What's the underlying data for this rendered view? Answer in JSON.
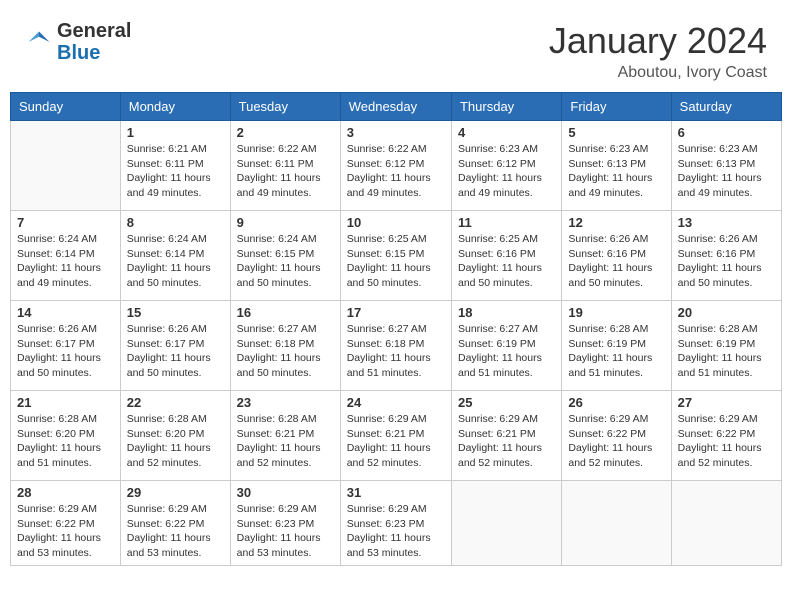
{
  "header": {
    "logo_general": "General",
    "logo_blue": "Blue",
    "month": "January 2024",
    "location": "Aboutou, Ivory Coast"
  },
  "weekdays": [
    "Sunday",
    "Monday",
    "Tuesday",
    "Wednesday",
    "Thursday",
    "Friday",
    "Saturday"
  ],
  "weeks": [
    [
      {
        "day": "",
        "sunrise": "",
        "sunset": "",
        "daylight": ""
      },
      {
        "day": "1",
        "sunrise": "Sunrise: 6:21 AM",
        "sunset": "Sunset: 6:11 PM",
        "daylight": "Daylight: 11 hours and 49 minutes."
      },
      {
        "day": "2",
        "sunrise": "Sunrise: 6:22 AM",
        "sunset": "Sunset: 6:11 PM",
        "daylight": "Daylight: 11 hours and 49 minutes."
      },
      {
        "day": "3",
        "sunrise": "Sunrise: 6:22 AM",
        "sunset": "Sunset: 6:12 PM",
        "daylight": "Daylight: 11 hours and 49 minutes."
      },
      {
        "day": "4",
        "sunrise": "Sunrise: 6:23 AM",
        "sunset": "Sunset: 6:12 PM",
        "daylight": "Daylight: 11 hours and 49 minutes."
      },
      {
        "day": "5",
        "sunrise": "Sunrise: 6:23 AM",
        "sunset": "Sunset: 6:13 PM",
        "daylight": "Daylight: 11 hours and 49 minutes."
      },
      {
        "day": "6",
        "sunrise": "Sunrise: 6:23 AM",
        "sunset": "Sunset: 6:13 PM",
        "daylight": "Daylight: 11 hours and 49 minutes."
      }
    ],
    [
      {
        "day": "7",
        "sunrise": "Sunrise: 6:24 AM",
        "sunset": "Sunset: 6:14 PM",
        "daylight": "Daylight: 11 hours and 49 minutes."
      },
      {
        "day": "8",
        "sunrise": "Sunrise: 6:24 AM",
        "sunset": "Sunset: 6:14 PM",
        "daylight": "Daylight: 11 hours and 50 minutes."
      },
      {
        "day": "9",
        "sunrise": "Sunrise: 6:24 AM",
        "sunset": "Sunset: 6:15 PM",
        "daylight": "Daylight: 11 hours and 50 minutes."
      },
      {
        "day": "10",
        "sunrise": "Sunrise: 6:25 AM",
        "sunset": "Sunset: 6:15 PM",
        "daylight": "Daylight: 11 hours and 50 minutes."
      },
      {
        "day": "11",
        "sunrise": "Sunrise: 6:25 AM",
        "sunset": "Sunset: 6:16 PM",
        "daylight": "Daylight: 11 hours and 50 minutes."
      },
      {
        "day": "12",
        "sunrise": "Sunrise: 6:26 AM",
        "sunset": "Sunset: 6:16 PM",
        "daylight": "Daylight: 11 hours and 50 minutes."
      },
      {
        "day": "13",
        "sunrise": "Sunrise: 6:26 AM",
        "sunset": "Sunset: 6:16 PM",
        "daylight": "Daylight: 11 hours and 50 minutes."
      }
    ],
    [
      {
        "day": "14",
        "sunrise": "Sunrise: 6:26 AM",
        "sunset": "Sunset: 6:17 PM",
        "daylight": "Daylight: 11 hours and 50 minutes."
      },
      {
        "day": "15",
        "sunrise": "Sunrise: 6:26 AM",
        "sunset": "Sunset: 6:17 PM",
        "daylight": "Daylight: 11 hours and 50 minutes."
      },
      {
        "day": "16",
        "sunrise": "Sunrise: 6:27 AM",
        "sunset": "Sunset: 6:18 PM",
        "daylight": "Daylight: 11 hours and 50 minutes."
      },
      {
        "day": "17",
        "sunrise": "Sunrise: 6:27 AM",
        "sunset": "Sunset: 6:18 PM",
        "daylight": "Daylight: 11 hours and 51 minutes."
      },
      {
        "day": "18",
        "sunrise": "Sunrise: 6:27 AM",
        "sunset": "Sunset: 6:19 PM",
        "daylight": "Daylight: 11 hours and 51 minutes."
      },
      {
        "day": "19",
        "sunrise": "Sunrise: 6:28 AM",
        "sunset": "Sunset: 6:19 PM",
        "daylight": "Daylight: 11 hours and 51 minutes."
      },
      {
        "day": "20",
        "sunrise": "Sunrise: 6:28 AM",
        "sunset": "Sunset: 6:19 PM",
        "daylight": "Daylight: 11 hours and 51 minutes."
      }
    ],
    [
      {
        "day": "21",
        "sunrise": "Sunrise: 6:28 AM",
        "sunset": "Sunset: 6:20 PM",
        "daylight": "Daylight: 11 hours and 51 minutes."
      },
      {
        "day": "22",
        "sunrise": "Sunrise: 6:28 AM",
        "sunset": "Sunset: 6:20 PM",
        "daylight": "Daylight: 11 hours and 52 minutes."
      },
      {
        "day": "23",
        "sunrise": "Sunrise: 6:28 AM",
        "sunset": "Sunset: 6:21 PM",
        "daylight": "Daylight: 11 hours and 52 minutes."
      },
      {
        "day": "24",
        "sunrise": "Sunrise: 6:29 AM",
        "sunset": "Sunset: 6:21 PM",
        "daylight": "Daylight: 11 hours and 52 minutes."
      },
      {
        "day": "25",
        "sunrise": "Sunrise: 6:29 AM",
        "sunset": "Sunset: 6:21 PM",
        "daylight": "Daylight: 11 hours and 52 minutes."
      },
      {
        "day": "26",
        "sunrise": "Sunrise: 6:29 AM",
        "sunset": "Sunset: 6:22 PM",
        "daylight": "Daylight: 11 hours and 52 minutes."
      },
      {
        "day": "27",
        "sunrise": "Sunrise: 6:29 AM",
        "sunset": "Sunset: 6:22 PM",
        "daylight": "Daylight: 11 hours and 52 minutes."
      }
    ],
    [
      {
        "day": "28",
        "sunrise": "Sunrise: 6:29 AM",
        "sunset": "Sunset: 6:22 PM",
        "daylight": "Daylight: 11 hours and 53 minutes."
      },
      {
        "day": "29",
        "sunrise": "Sunrise: 6:29 AM",
        "sunset": "Sunset: 6:22 PM",
        "daylight": "Daylight: 11 hours and 53 minutes."
      },
      {
        "day": "30",
        "sunrise": "Sunrise: 6:29 AM",
        "sunset": "Sunset: 6:23 PM",
        "daylight": "Daylight: 11 hours and 53 minutes."
      },
      {
        "day": "31",
        "sunrise": "Sunrise: 6:29 AM",
        "sunset": "Sunset: 6:23 PM",
        "daylight": "Daylight: 11 hours and 53 minutes."
      },
      {
        "day": "",
        "sunrise": "",
        "sunset": "",
        "daylight": ""
      },
      {
        "day": "",
        "sunrise": "",
        "sunset": "",
        "daylight": ""
      },
      {
        "day": "",
        "sunrise": "",
        "sunset": "",
        "daylight": ""
      }
    ]
  ]
}
